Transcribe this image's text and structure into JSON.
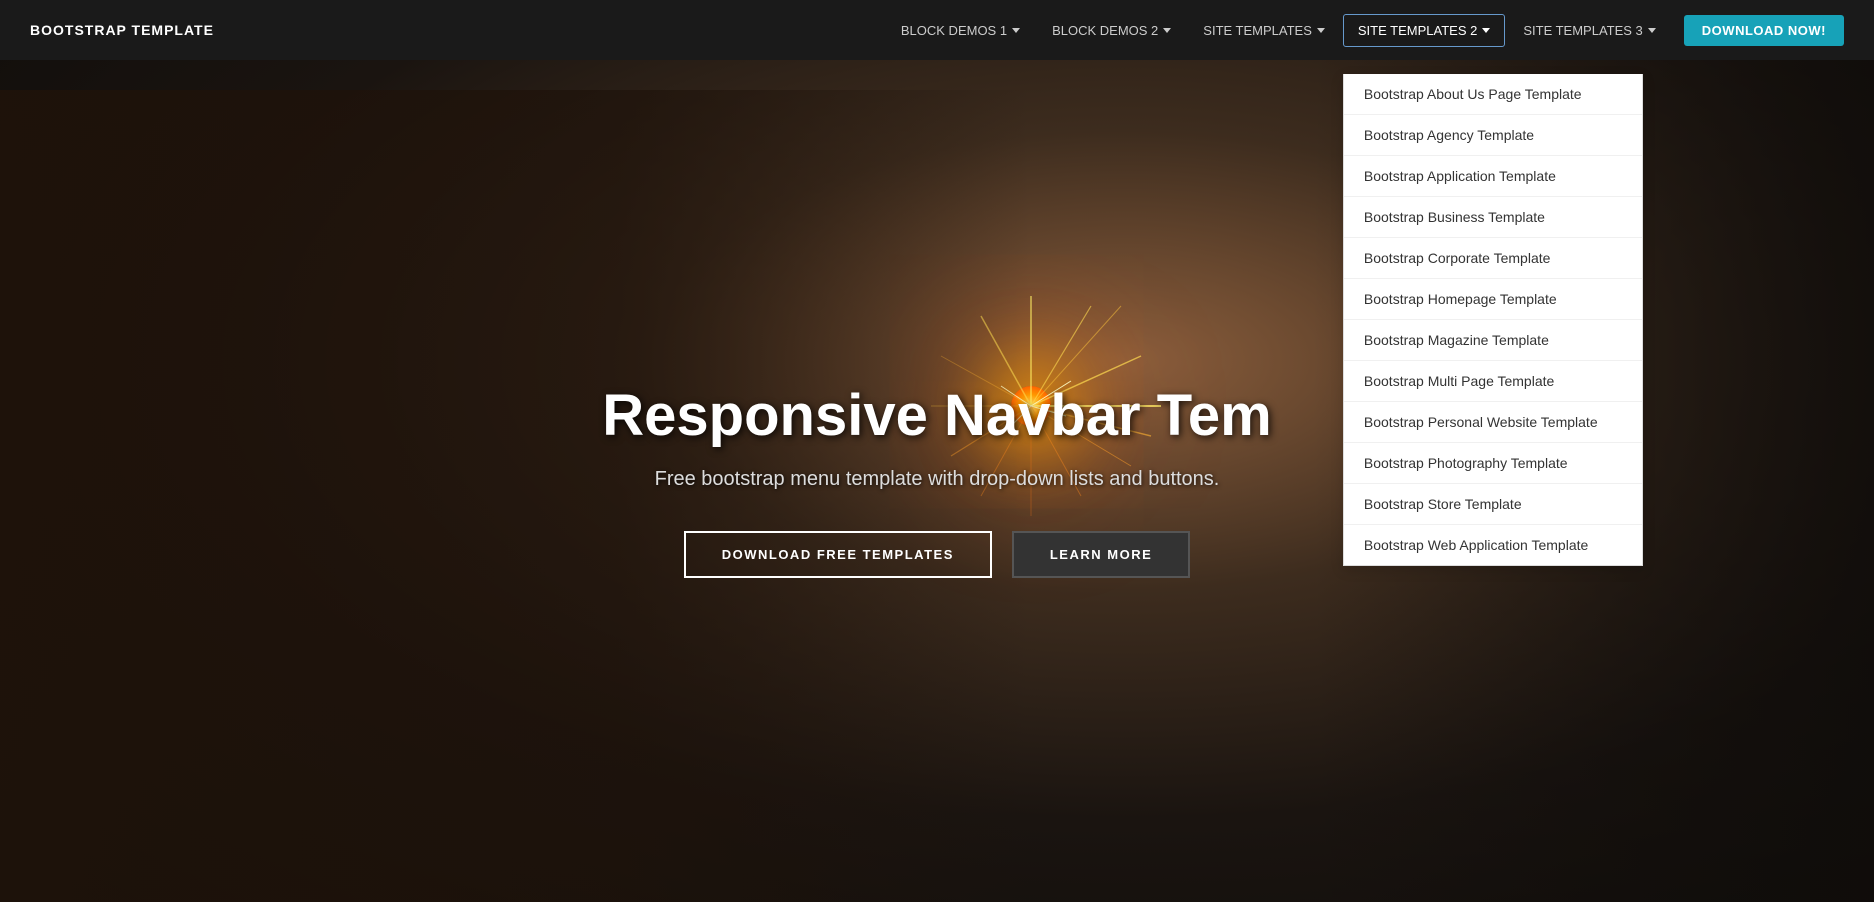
{
  "brand": "BOOTSTRAP TEMPLATE",
  "nav": {
    "items": [
      {
        "id": "block-demos-1",
        "label": "BLOCK DEMOS 1",
        "hasCaret": true
      },
      {
        "id": "block-demos-2",
        "label": "BLOCK DEMOS 2",
        "hasCaret": true
      },
      {
        "id": "site-templates",
        "label": "SITE TEMPLATES",
        "hasCaret": true
      },
      {
        "id": "site-templates-2",
        "label": "SITE TEMPLATES 2",
        "hasCaret": true,
        "active": true
      },
      {
        "id": "site-templates-3",
        "label": "SITE TEMPLATES 3",
        "hasCaret": true
      }
    ],
    "download_label": "DOWNLOAD NOW!"
  },
  "dropdown": {
    "items": [
      "Bootstrap About Us Page Template",
      "Bootstrap Agency Template",
      "Bootstrap Application Template",
      "Bootstrap Business Template",
      "Bootstrap Corporate Template",
      "Bootstrap Homepage Template",
      "Bootstrap Magazine Template",
      "Bootstrap Multi Page Template",
      "Bootstrap Personal Website Template",
      "Bootstrap Photography Template",
      "Bootstrap Store Template",
      "Bootstrap Web Application Template"
    ]
  },
  "hero": {
    "title": "Responsive Navbar Tem",
    "subtitle": "Free bootstrap menu template with drop-down lists and buttons.",
    "btn_download": "DOWNLOAD FREE TEMPLATES",
    "btn_learn": "LEARN MORE"
  },
  "colors": {
    "navbar_bg": "#1a1a1a",
    "download_btn": "#17a2b8",
    "active_border": "#6699cc"
  }
}
